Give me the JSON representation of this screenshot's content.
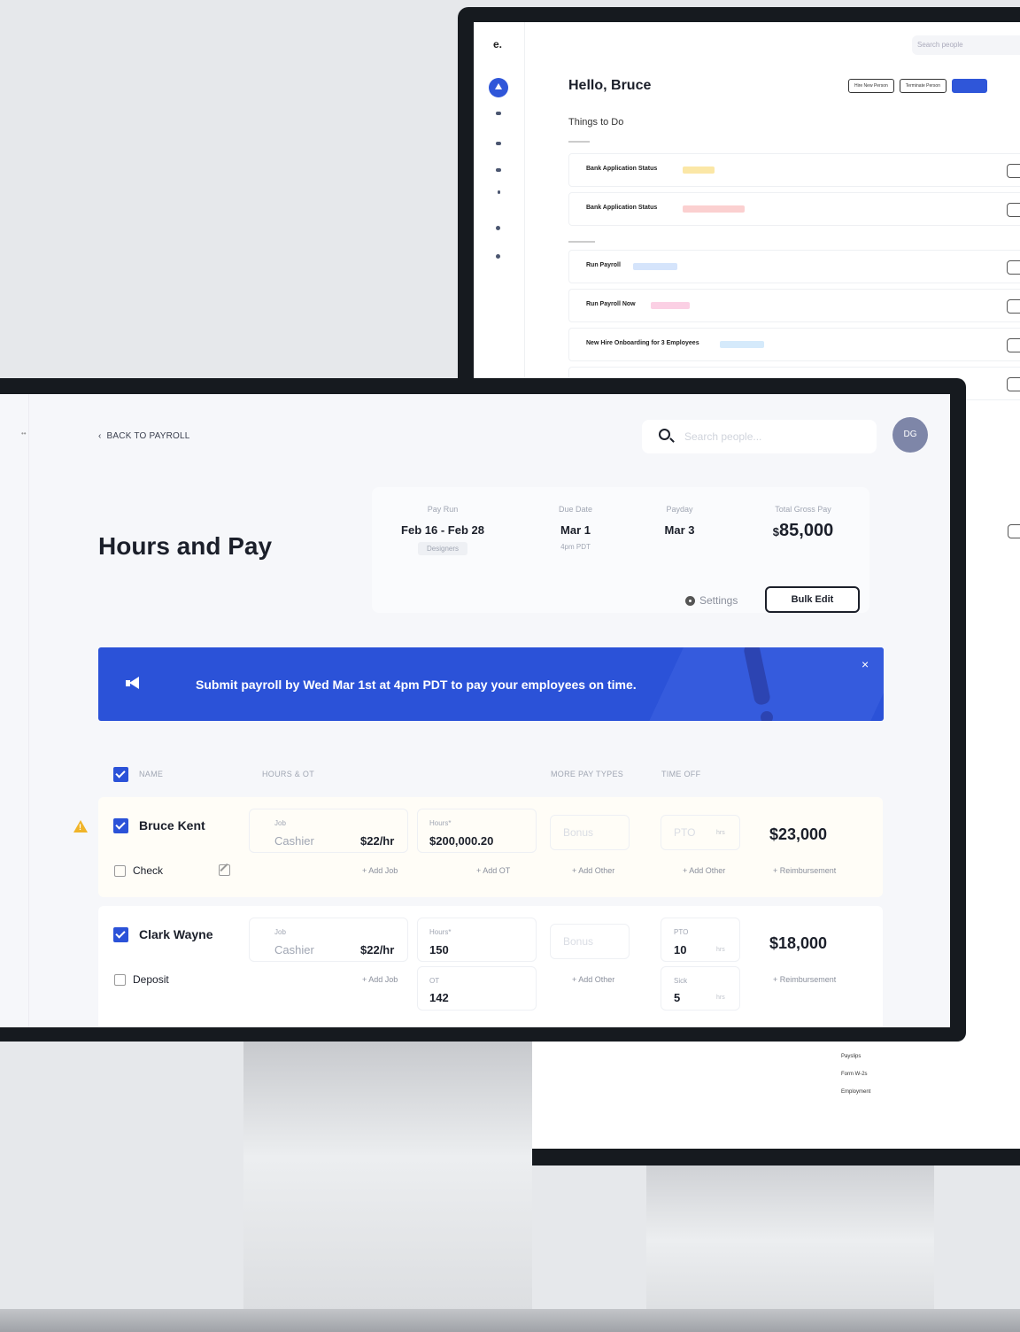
{
  "back_screen": {
    "logo": "e.",
    "greeting": "Hello, Bruce",
    "search_placeholder": "Search people",
    "header_buttons": [
      "Hire New Person",
      "Terminate Person",
      ""
    ],
    "section_title": "Things to Do",
    "rows": [
      {
        "title": "Bank Application Status",
        "tag_color": "#fbe7a6"
      },
      {
        "title": "Bank Application Status",
        "tag_color": "#fbd0d0"
      },
      {
        "title": "Run Payroll",
        "tag_color": "#d5e4fb"
      },
      {
        "title": "Run Payroll Now",
        "tag_color": "#fbd0e4"
      },
      {
        "title": "New Hire Onboarding for 3 Employees",
        "tag_color": "#d5eafb"
      }
    ],
    "lower_items": [
      "Payslips",
      "Form W-2s",
      "Employment"
    ]
  },
  "front_screen": {
    "back_link": "BACK TO PAYROLL",
    "search_placeholder": "Search people...",
    "avatar_initials": "DG",
    "page_title": "Hours and Pay",
    "summary": {
      "pay_run_label": "Pay Run",
      "pay_run_value": "Feb 16 - Feb 28",
      "pay_run_tag": "Designers",
      "due_date_label": "Due Date",
      "due_date_value": "Mar 1",
      "due_date_sub": "4pm PDT",
      "payday_label": "Payday",
      "payday_value": "Mar 3",
      "gross_label": "Total Gross Pay",
      "gross_currency": "$",
      "gross_value": "85,000",
      "settings_label": "Settings",
      "bulk_edit_label": "Bulk Edit"
    },
    "banner": {
      "message": "Submit payroll by Wed Mar 1st at 4pm PDT to pay your employees on time.",
      "close": "×",
      "color": "#2b52d8"
    },
    "table_headers": {
      "name": "NAME",
      "hours": "HOURS & OT",
      "more_pay": "MORE PAY TYPES",
      "time_off": "TIME OFF"
    },
    "employees": [
      {
        "name": "Bruce Kent",
        "pay_method": "Check",
        "job_label": "Job",
        "job": "Cashier",
        "rate": "$22/hr",
        "hours_label": "Hours*",
        "hours": "$200,000.20",
        "bonus_placeholder": "Bonus",
        "pto_placeholder": "PTO",
        "hrs_unit": "hrs",
        "add_job": "+ Add Job",
        "add_ot": "+ Add OT",
        "add_other_pay": "+ Add Other",
        "add_other_time": "+ Add Other",
        "total": "$23,000",
        "reimbursement": "+ Reimbursement"
      },
      {
        "name": "Clark Wayne",
        "pay_method": "Deposit",
        "job_label": "Job",
        "job": "Cashier",
        "rate": "$22/hr",
        "hours_label": "Hours*",
        "hours": "150",
        "ot_label": "OT",
        "ot": "142",
        "bonus_placeholder": "Bonus",
        "pto_label": "PTO",
        "pto": "10",
        "sick_label": "Sick",
        "sick": "5",
        "hrs_unit": "hrs",
        "add_job": "+ Add Job",
        "add_other_pay": "+ Add Other",
        "total": "$18,000",
        "reimbursement": "+ Reimbursement"
      }
    ]
  }
}
